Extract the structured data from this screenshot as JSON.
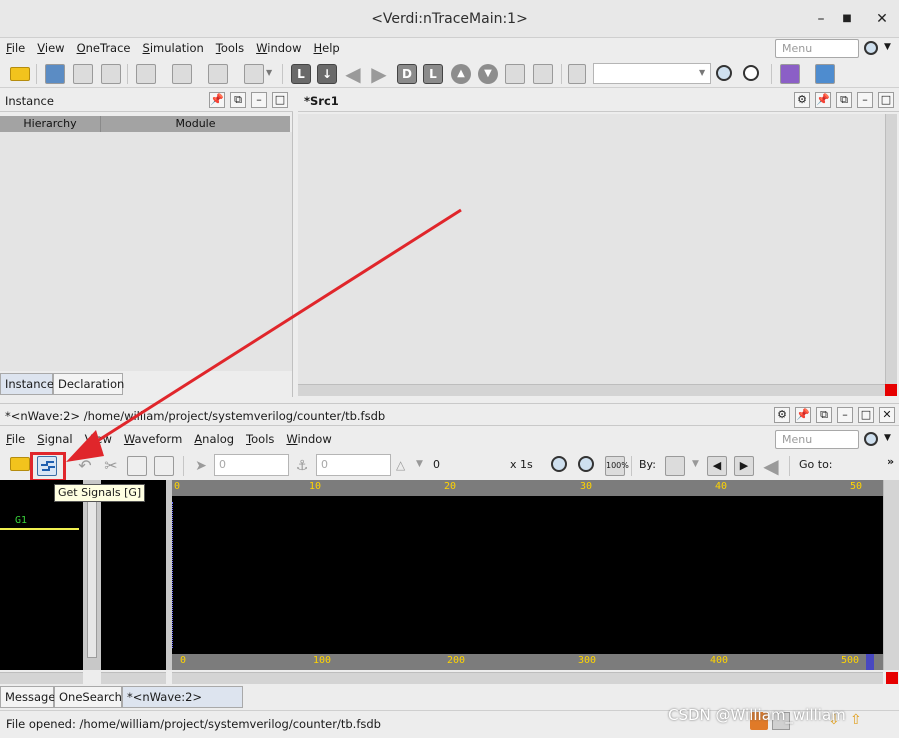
{
  "window": {
    "title": "<Verdi:nTraceMain:1>",
    "minimize": "–",
    "maximize": "■",
    "close": "✕"
  },
  "main_menu": {
    "items": [
      "File",
      "View",
      "OneTrace",
      "Simulation",
      "Tools",
      "Window",
      "Help"
    ],
    "search_placeholder": "Menu"
  },
  "instance_pane": {
    "title": "Instance",
    "columns": [
      "Hierarchy",
      "Module"
    ],
    "tabs": [
      "Instance",
      "Declaration"
    ]
  },
  "src_pane": {
    "title": "*Src1"
  },
  "nwave": {
    "title": "*<nWave:2> /home/william/project/systemverilog/counter/tb.fsdb",
    "menu": [
      "File",
      "Signal",
      "View",
      "Waveform",
      "Analog",
      "Tools",
      "Window"
    ],
    "search_placeholder": "Menu",
    "cursor_value_1": "0",
    "cursor_value_2": "0",
    "delta_value": "0",
    "zoom_label": "x 1s",
    "by_label": "By:",
    "goto_label": "Go to:",
    "more": "»",
    "tooltip": "Get Signals [G]",
    "group_label": "G1",
    "ruler_top": [
      "0",
      "10",
      "20",
      "30",
      "40",
      "50"
    ],
    "ruler_bottom": [
      "0",
      "100",
      "200",
      "300",
      "400",
      "500"
    ]
  },
  "bottom_tabs": [
    "Message",
    "OneSearch",
    "*<nWave:2> tb.fsdb"
  ],
  "status_text": "File opened: /home/william/project/systemverilog/counter/tb.fsdb",
  "watermark": "CSDN @William_william",
  "colors": {
    "annotation_red": "#e0262b",
    "ruler_text": "#ffd400",
    "group_green": "#39d43a",
    "signal_line": "#f0f050"
  }
}
